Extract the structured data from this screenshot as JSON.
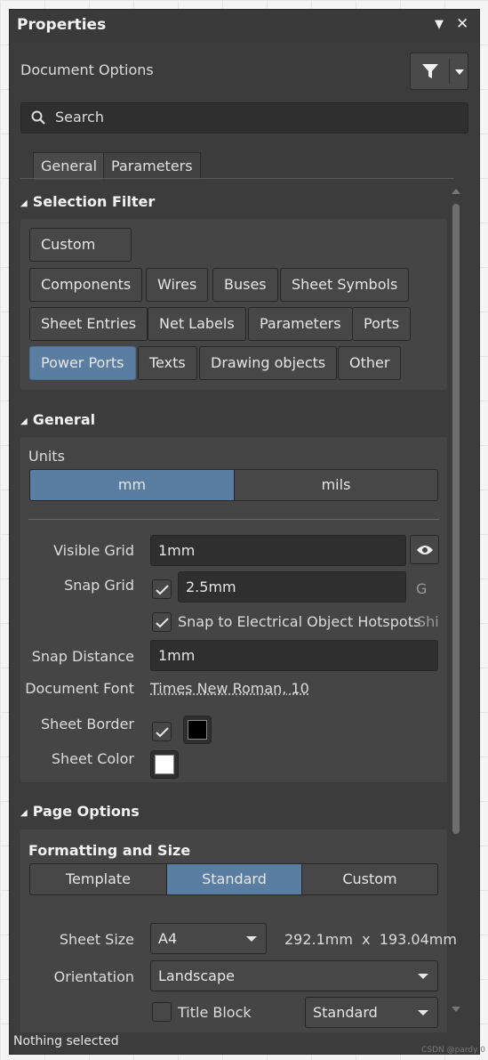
{
  "panel": {
    "title": "Properties",
    "pin_glyph": "▼",
    "close_glyph": "✕",
    "doc_options": "Document Options",
    "search_placeholder": "Search"
  },
  "tabs": [
    {
      "label": "General",
      "active": true
    },
    {
      "label": "Parameters",
      "active": false
    }
  ],
  "selection_filter": {
    "heading": "Selection Filter",
    "chips": [
      {
        "label": "Custom"
      },
      {
        "label": "Components"
      },
      {
        "label": "Wires"
      },
      {
        "label": "Buses"
      },
      {
        "label": "Sheet Symbols"
      },
      {
        "label": "Sheet Entries"
      },
      {
        "label": "Net Labels"
      },
      {
        "label": "Parameters"
      },
      {
        "label": "Ports"
      },
      {
        "label": "Power Ports",
        "selected": true
      },
      {
        "label": "Texts"
      },
      {
        "label": "Drawing objects"
      },
      {
        "label": "Other"
      }
    ]
  },
  "general": {
    "heading": "General",
    "units_label": "Units",
    "units": [
      {
        "label": "mm",
        "selected": true
      },
      {
        "label": "mils",
        "selected": false
      }
    ],
    "visible_grid_label": "Visible Grid",
    "visible_grid_value": "1mm",
    "snap_grid_label": "Snap Grid",
    "snap_grid_checked": true,
    "snap_grid_value": "2.5mm",
    "snap_grid_hotkey": "G",
    "snap_hotspots_checked": true,
    "snap_hotspots_label": "Snap to Electrical Object Hotspots",
    "snap_hotspots_hotkey": "Shi",
    "snap_distance_label": "Snap Distance",
    "snap_distance_value": "1mm",
    "document_font_label": "Document Font",
    "document_font_value": "Times New Roman, 10",
    "sheet_border_label": "Sheet Border",
    "sheet_border_checked": true,
    "sheet_border_color": "#000000",
    "sheet_color_label": "Sheet Color",
    "sheet_color": "#ffffff"
  },
  "page_options": {
    "heading": "Page Options",
    "subheading": "Formatting and Size",
    "modes": [
      {
        "label": "Template",
        "selected": false
      },
      {
        "label": "Standard",
        "selected": true
      },
      {
        "label": "Custom",
        "selected": false
      }
    ],
    "sheet_size_label": "Sheet Size",
    "sheet_size_value": "A4",
    "sheet_dimensions": "292.1mm  x  193.04mm",
    "orientation_label": "Orientation",
    "orientation_value": "Landscape",
    "title_block_checked": false,
    "title_block_label": "Title Block",
    "title_block_value": "Standard"
  },
  "status": "Nothing selected",
  "watermark": "CSDN @pardy 0",
  "colors": {
    "panel_bg": "#3c3c3c",
    "box_bg": "#454545",
    "accent": "#5a7da2"
  }
}
